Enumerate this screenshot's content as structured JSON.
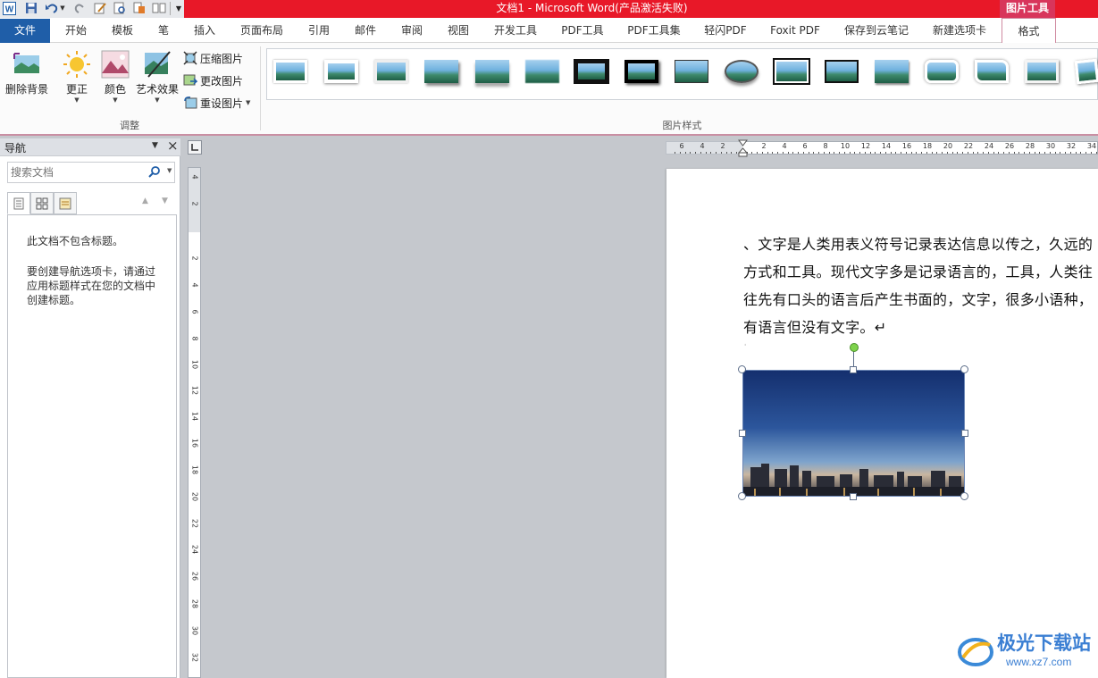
{
  "window": {
    "title": "文档1 - Microsoft Word(产品激活失败)",
    "context_tab_group": "图片工具"
  },
  "tabs": [
    "开始",
    "模板",
    "笔",
    "插入",
    "页面布局",
    "引用",
    "邮件",
    "审阅",
    "视图",
    "开发工具",
    "PDF工具",
    "PDF工具集",
    "轻闪PDF",
    "Foxit PDF",
    "保存到云笔记",
    "新建选项卡"
  ],
  "file_tab": "文件",
  "active_tab": "格式",
  "ribbon": {
    "remove_bg": "删除背景",
    "corrections": "更正",
    "color": "颜色",
    "artistic": "艺术效果",
    "compress": "压缩图片",
    "change": "更改图片",
    "reset": "重设图片",
    "adjust_group": "调整",
    "styles_group": "图片样式"
  },
  "nav": {
    "title": "导航",
    "search_placeholder": "搜索文档",
    "msg1": "此文档不包含标题。",
    "msg2": "要创建导航选项卡，请通过应用标题样式在您的文档中创建标题。"
  },
  "hruler_labels": [
    "6",
    "4",
    "2",
    "2",
    "4",
    "6",
    "8",
    "10",
    "12",
    "14",
    "16",
    "18",
    "20",
    "22",
    "24",
    "26",
    "28",
    "30",
    "32",
    "34"
  ],
  "vruler_labels": [
    "4",
    "2",
    "2",
    "4",
    "6",
    "8",
    "10",
    "12",
    "14",
    "16",
    "18",
    "20",
    "22",
    "24",
    "26",
    "28",
    "30",
    "32"
  ],
  "document": {
    "paragraph": "、文字是人类用表义符号记录表达信息以传之，久远的方式和工具。现代文字多是记录语言的，工具，人类往往先有口头的语言后产生书面的，文字，很多小语种，有语言但没有文字。↵"
  },
  "watermark": {
    "name": "极光下载站",
    "url": "www.xz7.com"
  },
  "colors": {
    "title_red": "#e81828",
    "file_tab": "#1f5ea8",
    "picture_tools": "#d8355b"
  }
}
